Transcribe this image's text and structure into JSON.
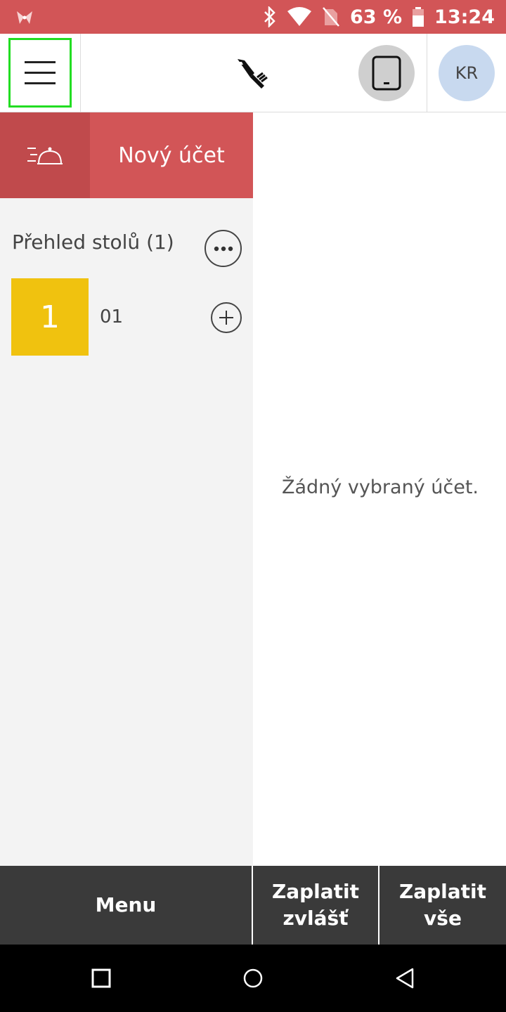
{
  "status_bar": {
    "battery_text": "63 %",
    "time": "13:24",
    "icons": [
      "app-notification-icon",
      "bluetooth-icon",
      "wifi-icon",
      "no-sim-icon",
      "battery-icon"
    ]
  },
  "header": {
    "menu_icon": "hamburger-icon",
    "logo_icon": "fork-logo-icon",
    "device_icon": "tablet-icon",
    "avatar_initials": "KR"
  },
  "actions": {
    "delivery_icon": "delivery-cloche-icon",
    "new_bill_label": "Nový účet"
  },
  "tables": {
    "title": "Přehled stolů (1)",
    "items": [
      {
        "number": "1",
        "name": "01",
        "color": "#f0c20f"
      }
    ]
  },
  "detail": {
    "empty_message": "Žádný vybraný účet."
  },
  "bottom": {
    "menu_label": "Menu",
    "split_line1": "Zaplatit",
    "split_line2": "zvlášť",
    "all_line1": "Zaplatit",
    "all_line2": "vše"
  },
  "colors": {
    "accent": "#d25557",
    "accent_dark": "#c04a4c",
    "bottom_bar": "#3a3a3a",
    "panel_bg": "#f3f3f3"
  }
}
